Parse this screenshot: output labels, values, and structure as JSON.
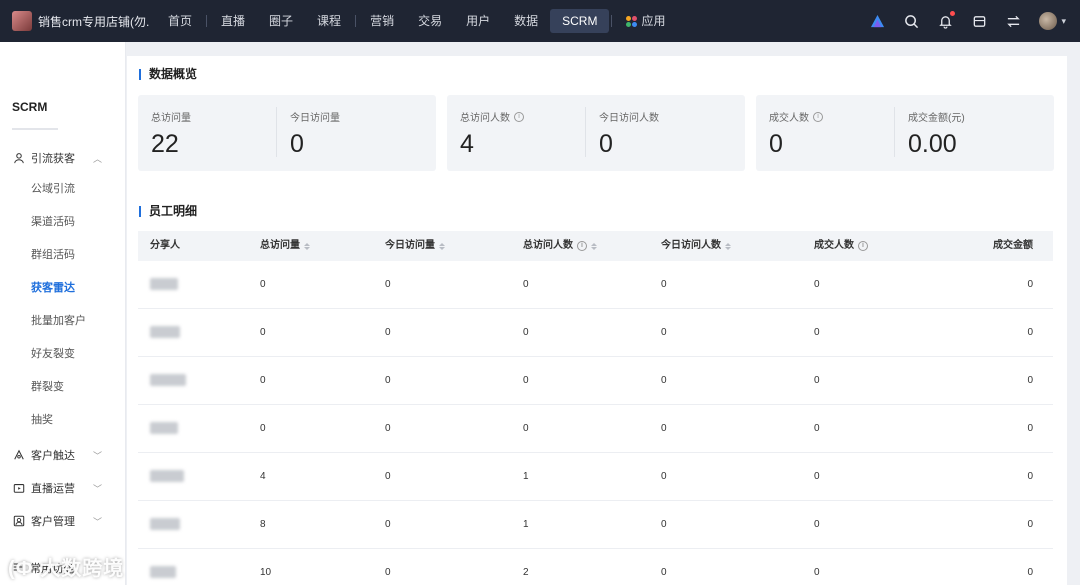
{
  "topbar": {
    "shop_name": "销售crm专用店铺(勿...",
    "nav": [
      "首页",
      "直播",
      "圈子",
      "课程",
      "营销",
      "交易",
      "用户",
      "数据",
      "SCRM"
    ],
    "nav_active": "SCRM",
    "apps_label": "应用",
    "icons": [
      "ai-icon",
      "search-icon",
      "bell-icon",
      "store-icon",
      "switch-icon",
      "user-avatar"
    ]
  },
  "sidebar": {
    "title": "SCRM",
    "groups": [
      {
        "label": "引流获客",
        "icon": "user-icon",
        "expanded": true
      },
      {
        "label": "客户触达",
        "icon": "reach-icon",
        "expanded": false
      },
      {
        "label": "直播运营",
        "icon": "live-icon",
        "expanded": false
      },
      {
        "label": "客户管理",
        "icon": "customer-icon",
        "expanded": false
      },
      {
        "label": "常用功能",
        "icon": "menu-icon",
        "expanded": false
      }
    ],
    "items": [
      "公域引流",
      "渠道活码",
      "群组活码",
      "获客雷达",
      "批量加客户",
      "好友裂变",
      "群裂变",
      "抽奖"
    ],
    "active_item": "获客雷达"
  },
  "overview": {
    "title": "数据概览",
    "cards": [
      [
        {
          "label": "总访问量",
          "value": "22",
          "info": false
        },
        {
          "label": "今日访问量",
          "value": "0",
          "info": false
        }
      ],
      [
        {
          "label": "总访问人数",
          "value": "4",
          "info": true
        },
        {
          "label": "今日访问人数",
          "value": "0",
          "info": false
        }
      ],
      [
        {
          "label": "成交人数",
          "value": "0",
          "info": true
        },
        {
          "label": "成交金额(元)",
          "value": "0.00",
          "info": false
        }
      ]
    ]
  },
  "staff": {
    "title": "员工明细",
    "columns": [
      "分享人",
      "总访问量",
      "今日访问量",
      "总访问人数",
      "今日访问人数",
      "成交人数",
      "成交金额"
    ],
    "rows": [
      [
        "",
        "0",
        "0",
        "0",
        "0",
        "0",
        "0"
      ],
      [
        "",
        "0",
        "0",
        "0",
        "0",
        "0",
        "0"
      ],
      [
        "",
        "0",
        "0",
        "0",
        "0",
        "0",
        "0"
      ],
      [
        "",
        "0",
        "0",
        "0",
        "0",
        "0",
        "0"
      ],
      [
        "",
        "4",
        "0",
        "1",
        "0",
        "0",
        "0"
      ],
      [
        "",
        "8",
        "0",
        "1",
        "0",
        "0",
        "0"
      ],
      [
        "",
        "10",
        "0",
        "2",
        "0",
        "0",
        "0"
      ]
    ]
  },
  "watermark": "(Ф 大数跨境",
  "colors": {
    "topbar": "#1f2533",
    "accent": "#1f6fdc",
    "card_bg": "#f2f4f7"
  }
}
